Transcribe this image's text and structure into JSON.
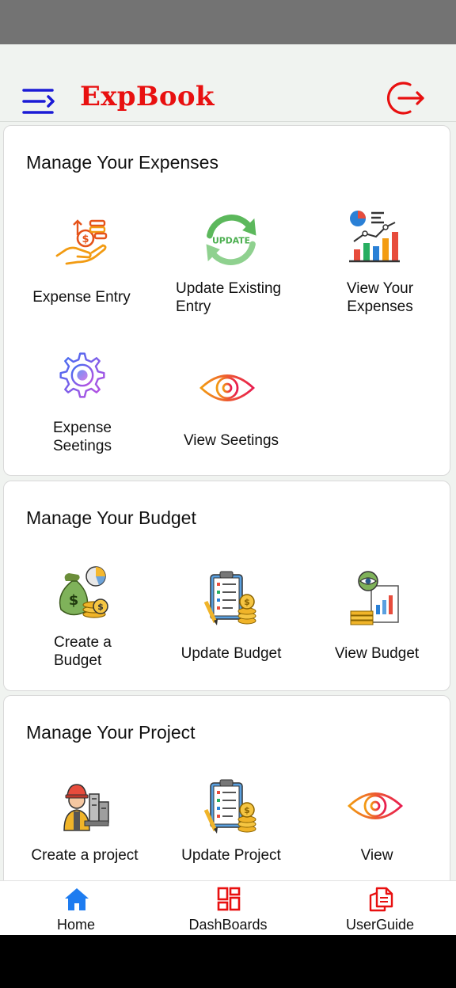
{
  "app": {
    "title": "ExpBook"
  },
  "icons": {
    "menu": "menu-icon",
    "logout": "logout-icon"
  },
  "colors": {
    "brand_red": "#e81010",
    "menu_blue": "#1a1ad6",
    "nav_blue": "#1e7cf0"
  },
  "sections": [
    {
      "title": "Manage Your Expenses",
      "items": [
        {
          "label": "Expense Entry",
          "icon": "money-hand-icon"
        },
        {
          "label": "Update Existing Entry",
          "icon": "update-cycle-icon"
        },
        {
          "label": "View Your Expenses",
          "icon": "analytics-chart-icon"
        },
        {
          "label": "Expense Seetings",
          "icon": "gear-icon"
        },
        {
          "label": "View Seetings",
          "icon": "eye-icon"
        }
      ]
    },
    {
      "title": "Manage Your Budget",
      "items": [
        {
          "label": "Create a Budget",
          "icon": "money-bag-icon"
        },
        {
          "label": "Update Budget",
          "icon": "clipboard-coins-icon"
        },
        {
          "label": "View Budget",
          "icon": "report-eye-icon"
        }
      ]
    },
    {
      "title": "Manage Your Project",
      "items": [
        {
          "label": "Create a project",
          "icon": "engineer-icon"
        },
        {
          "label": "Update Project",
          "icon": "clipboard-coins-icon"
        },
        {
          "label": "View",
          "icon": "eye-icon"
        }
      ]
    }
  ],
  "bottom_nav": [
    {
      "label": "Home",
      "icon": "home-icon"
    },
    {
      "label": "DashBoards",
      "icon": "dashboard-icon"
    },
    {
      "label": "UserGuide",
      "icon": "document-icon"
    }
  ]
}
